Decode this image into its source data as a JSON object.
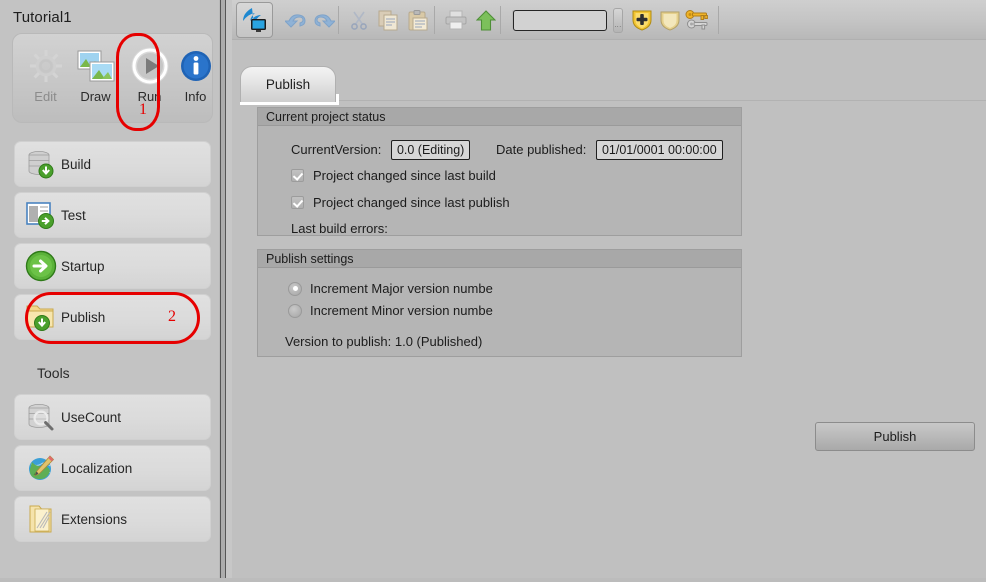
{
  "sidebar": {
    "project_title": "Tutorial1",
    "mode_buttons": [
      {
        "label": "Edit",
        "icon": "gear-icon",
        "enabled": false
      },
      {
        "label": "Draw",
        "icon": "pictures-icon",
        "enabled": true
      },
      {
        "label": "Run",
        "icon": "play-icon",
        "enabled": true
      },
      {
        "label": "Info",
        "icon": "info-icon",
        "enabled": true
      }
    ],
    "annotations": [
      {
        "step": "1",
        "target": "Run"
      },
      {
        "step": "2",
        "target": "Publish"
      }
    ],
    "nav_items": [
      {
        "label": "Build",
        "icon": "database-download-icon"
      },
      {
        "label": "Test",
        "icon": "window-run-icon"
      },
      {
        "label": "Startup",
        "icon": "green-arrow-circle-icon"
      },
      {
        "label": "Publish",
        "icon": "folder-download-icon",
        "step": "2"
      }
    ],
    "tools_heading": "Tools",
    "tool_items": [
      {
        "label": "UseCount",
        "icon": "database-magnifier-icon"
      },
      {
        "label": "Localization",
        "icon": "globe-pencil-icon"
      },
      {
        "label": "Extensions",
        "icon": "folder-extensions-icon"
      }
    ]
  },
  "toolbar": {
    "app_logo": "app-logo-icon",
    "items": [
      {
        "name": "undo-icon",
        "enabled": false
      },
      {
        "name": "redo-icon",
        "enabled": false
      },
      {
        "name": "cut-icon",
        "enabled": false
      },
      {
        "name": "copy-icon",
        "enabled": false
      },
      {
        "name": "paste-icon",
        "enabled": false
      },
      {
        "name": "print-icon",
        "enabled": false
      },
      {
        "name": "upload-arrow-icon",
        "enabled": true
      },
      {
        "name": "print-preview-icon",
        "enabled": false
      },
      {
        "name": "search-icon",
        "enabled": true
      },
      {
        "name": "shield-add-icon",
        "enabled": true
      },
      {
        "name": "shield-icon",
        "enabled": true
      },
      {
        "name": "keys-icon",
        "enabled": true
      }
    ],
    "search_value": "",
    "search_placeholder": "",
    "overflow_label": "..."
  },
  "tabs": [
    {
      "label": "Publish",
      "active": true
    }
  ],
  "status_group": {
    "title": "Current project status",
    "current_version_label": "CurrentVersion:",
    "current_version_value": "0.0 (Editing)",
    "date_published_label": "Date published:",
    "date_published_value": "01/01/0001 00:00:00",
    "checkboxes": [
      {
        "label": "Project changed since last build",
        "checked": true
      },
      {
        "label": "Project changed since last publish",
        "checked": true
      }
    ],
    "last_build_errors_label": "Last build errors:",
    "last_build_errors_value": ""
  },
  "settings_group": {
    "title": "Publish settings",
    "options": [
      {
        "label": "Increment Major version numbe",
        "selected": true
      },
      {
        "label": "Increment Minor version numbe",
        "selected": false
      }
    ],
    "version_to_publish": "Version to publish: 1.0 (Published)"
  },
  "publish_button_label": "Publish",
  "colors": {
    "annotation_red": "#e60000",
    "window_background": "#c0c0c0",
    "group_background": "#b5b5b5",
    "group_header": "#a8a8a8",
    "nav_button": "#dcdcdc"
  }
}
